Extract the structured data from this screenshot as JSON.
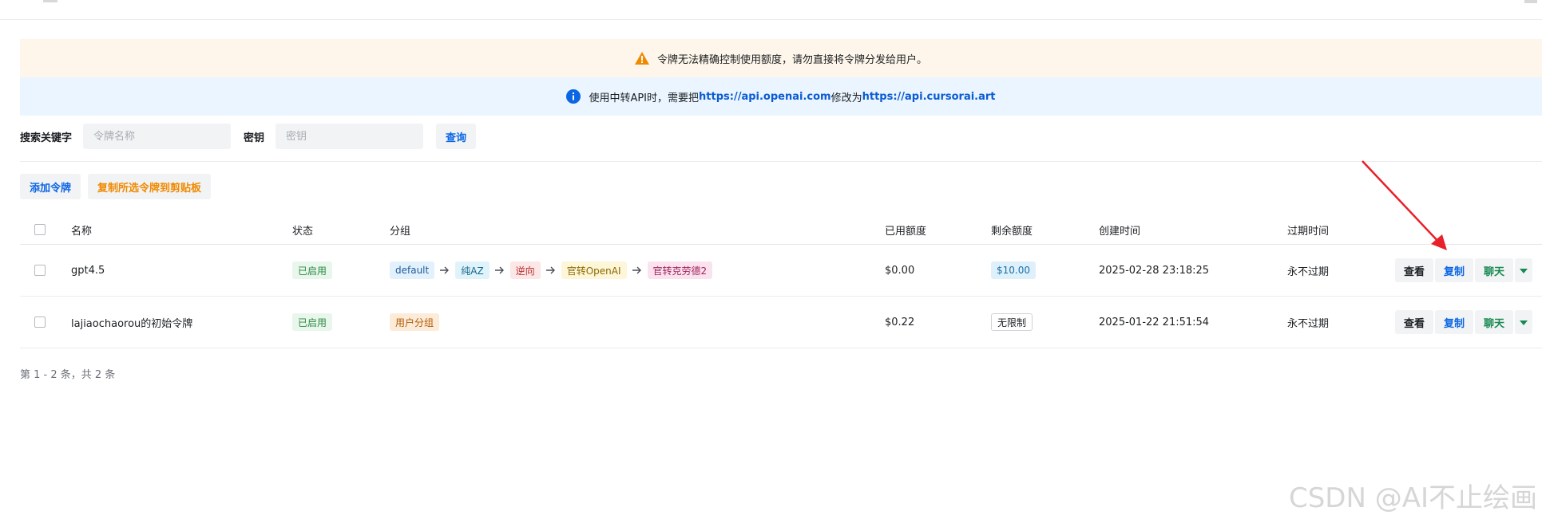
{
  "banners": {
    "warning_text": "令牌无法精确控制使用额度，请勿直接将令牌分发给用户。",
    "info_prefix": "使用中转API时，需要把",
    "info_link1": "https://api.openai.com",
    "info_mid": "修改为",
    "info_link2": "https://api.cursorai.art",
    "warning_color": "#f08a00",
    "info_color": "#0b66e4"
  },
  "search": {
    "keyword_label": "搜索关键字",
    "keyword_placeholder": "令牌名称",
    "secret_label": "密钥",
    "secret_placeholder": "密钥",
    "query_button": "查询"
  },
  "actions": {
    "add_token": "添加令牌",
    "copy_selected": "复制所选令牌到剪贴板"
  },
  "table": {
    "headers": {
      "name": "名称",
      "status": "状态",
      "group": "分组",
      "used": "已用额度",
      "remaining": "剩余额度",
      "created": "创建时间",
      "expire": "过期时间"
    },
    "rows": [
      {
        "name": "gpt4.5",
        "status": "已启用",
        "groups": [
          "default",
          "纯AZ",
          "逆向",
          "官转OpenAI",
          "官转克劳德2"
        ],
        "used": "$0.00",
        "remaining": "$10.00",
        "created": "2025-02-28 23:18:25",
        "expire": "永不过期"
      },
      {
        "name": "lajiaochaorou的初始令牌",
        "status": "已启用",
        "groups": [
          "用户分组"
        ],
        "used": "$0.22",
        "remaining": "无限制",
        "created": "2025-01-22 21:51:54",
        "expire": "永不过期"
      }
    ],
    "row_actions": {
      "view": "查看",
      "copy": "复制",
      "chat": "聊天"
    }
  },
  "pagination": {
    "text": "第 1 - 2 条，共 2 条"
  },
  "watermark": "CSDN @AI不止绘画"
}
